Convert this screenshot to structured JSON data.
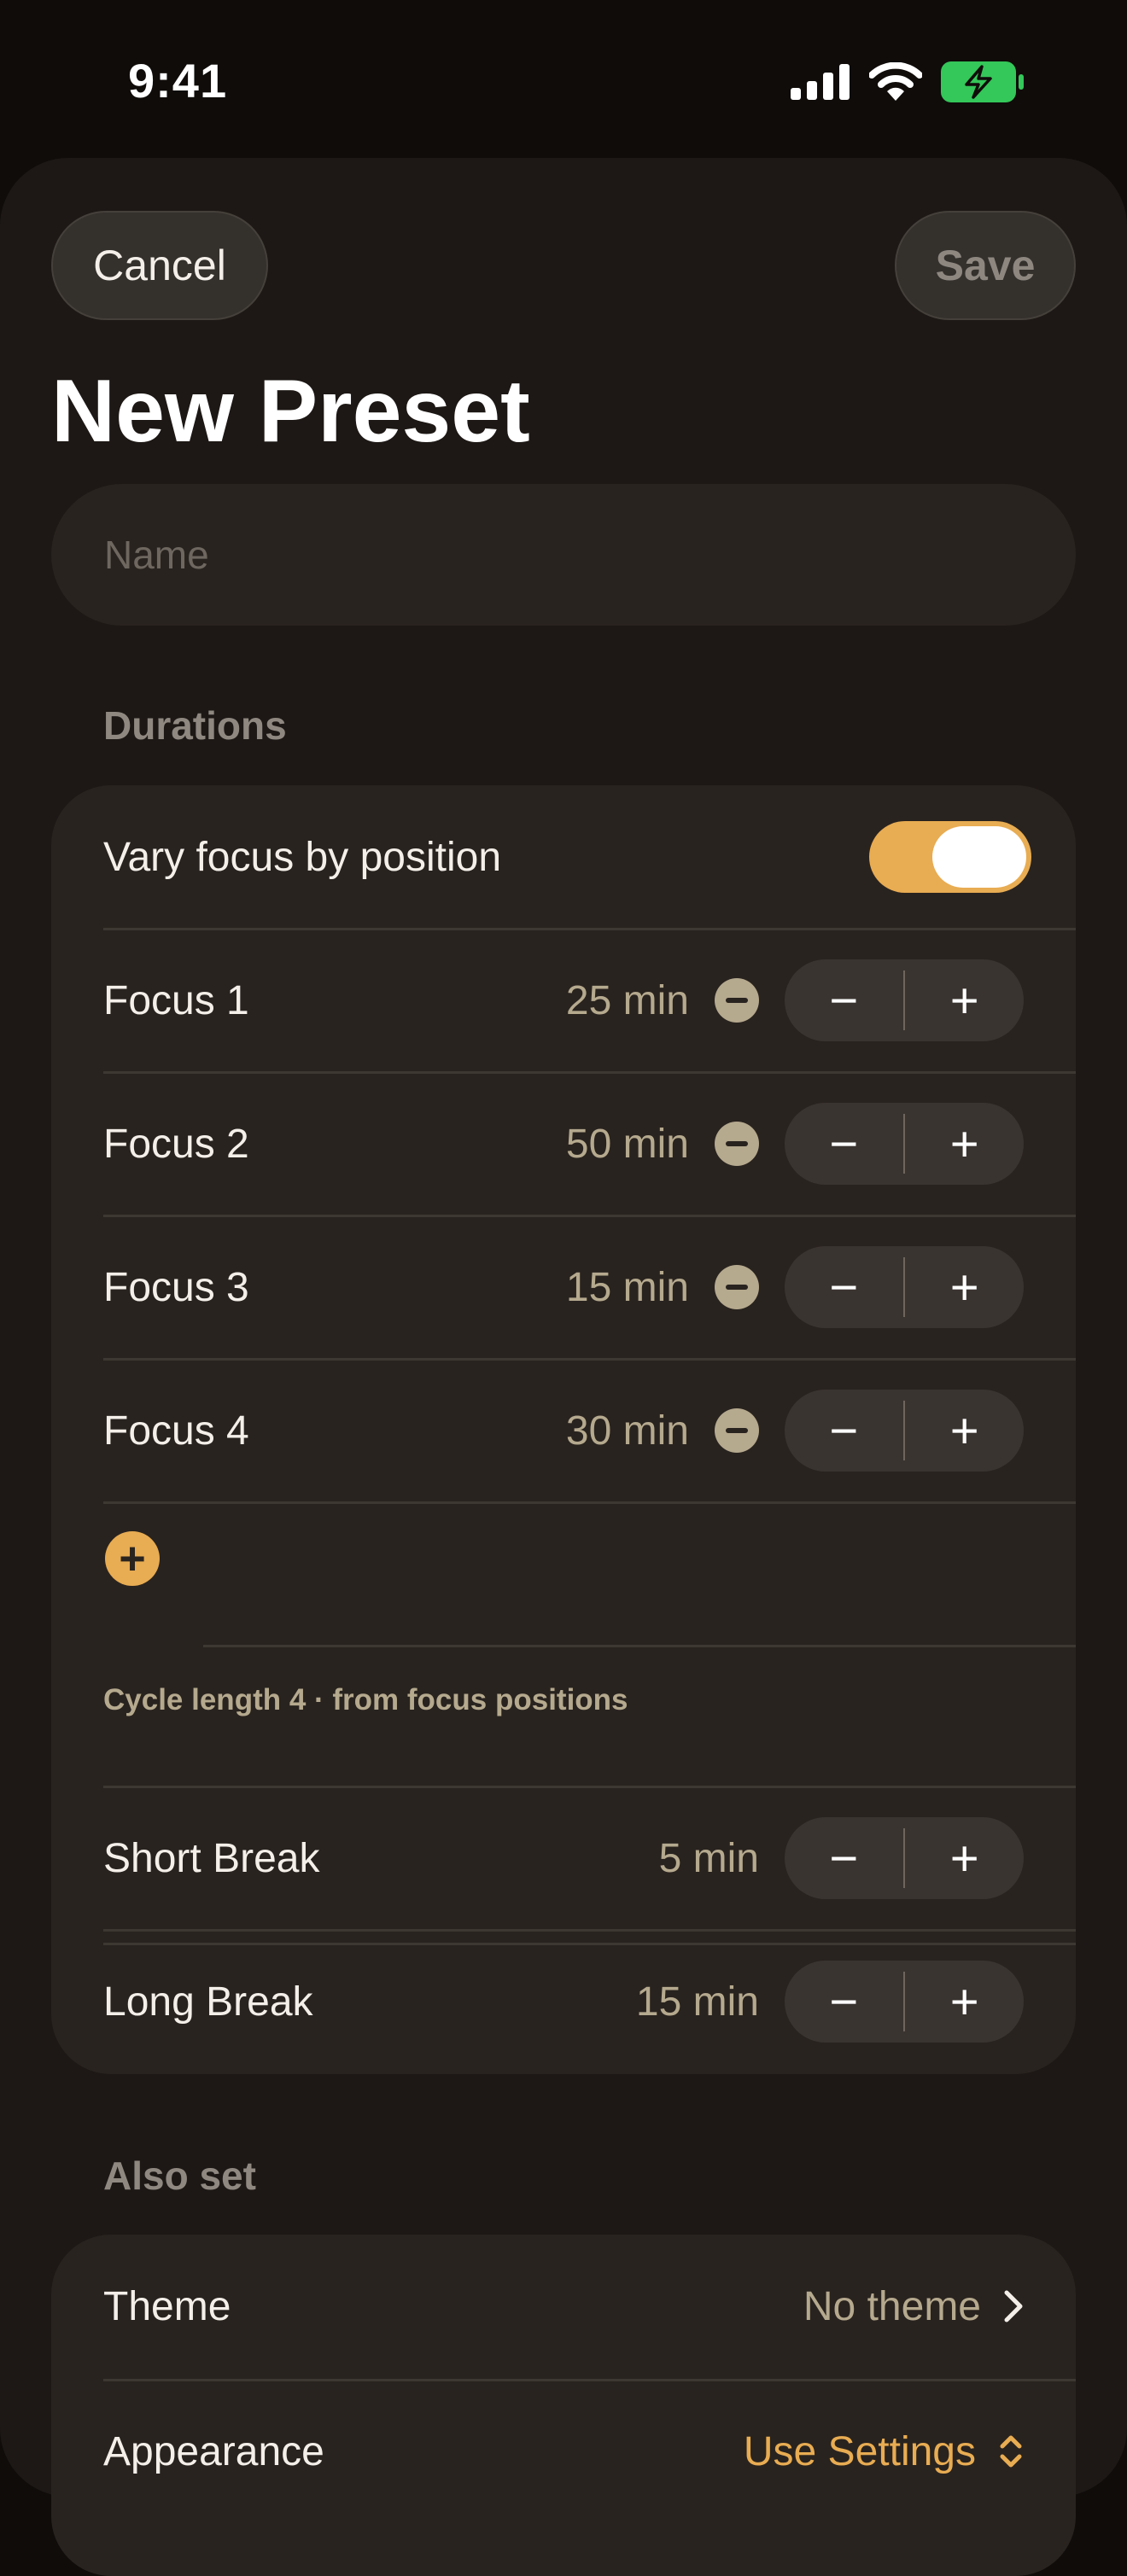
{
  "status_bar": {
    "time": "9:41",
    "icons": [
      "cellular-signal-icon",
      "wifi-icon",
      "battery-charging-icon"
    ],
    "battery_color": "#34c759"
  },
  "sheet": {
    "cancel_label": "Cancel",
    "save_label": "Save",
    "title": "New Preset",
    "name_placeholder": "Name",
    "name_value": ""
  },
  "durations": {
    "header": "Durations",
    "vary_label": "Vary focus by position",
    "vary_on": true,
    "focus_rows": [
      {
        "label": "Focus 1",
        "value": "25 min"
      },
      {
        "label": "Focus 2",
        "value": "50 min"
      },
      {
        "label": "Focus 3",
        "value": "15 min"
      },
      {
        "label": "Focus 4",
        "value": "30 min"
      }
    ],
    "add_focus_icon": "plus-circle-icon",
    "cycle_caption": "Cycle length 4 · from focus positions",
    "short_break": {
      "label": "Short Break",
      "value": "5 min"
    },
    "long_break": {
      "label": "Long Break",
      "value": "15 min"
    },
    "stepper_minus": "−",
    "stepper_plus": "+"
  },
  "also_set": {
    "header": "Also set",
    "theme_label": "Theme",
    "theme_value": "No theme",
    "appearance_label": "Appearance",
    "appearance_value": "Use Settings"
  },
  "colors": {
    "accent": "#e8ac52",
    "background": "#0f0c0a",
    "sheet": "#1d1815",
    "card": "#29231f",
    "value_text": "#b5a98e"
  }
}
